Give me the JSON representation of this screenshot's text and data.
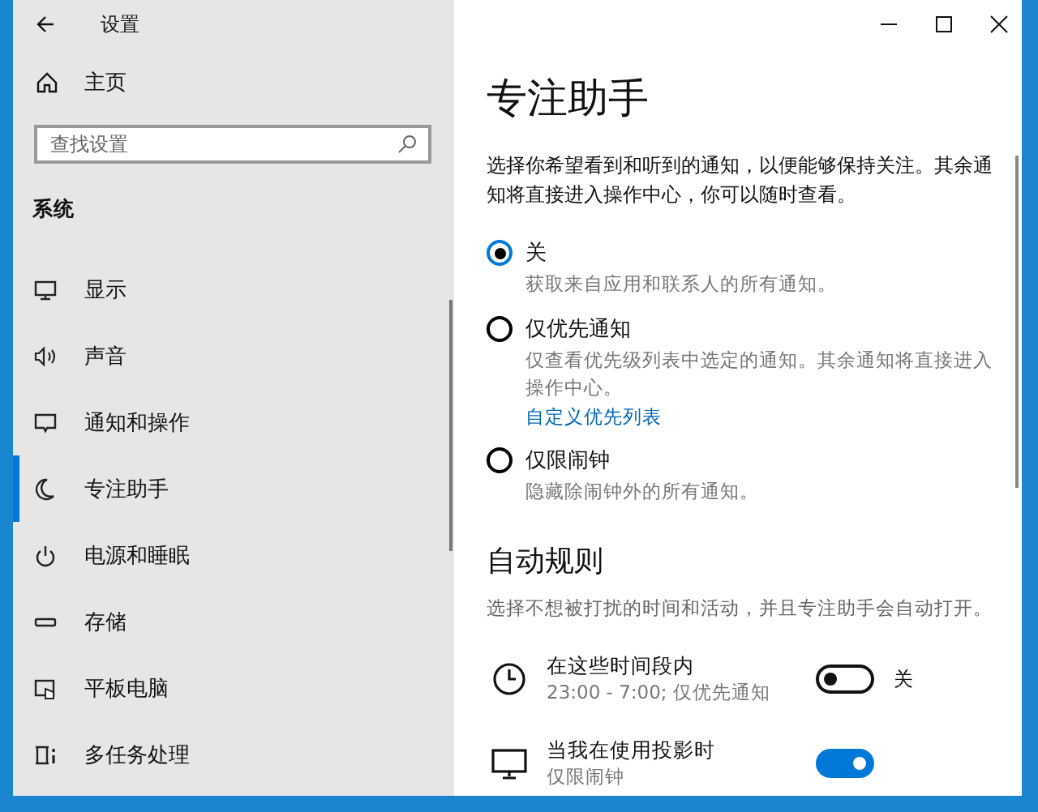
{
  "window": {
    "title": "设置"
  },
  "sidebar": {
    "home": "主页",
    "search": {
      "placeholder": "查找设置"
    },
    "section": "系统",
    "items": [
      {
        "label": "显示",
        "selected": false
      },
      {
        "label": "声音",
        "selected": false
      },
      {
        "label": "通知和操作",
        "selected": false
      },
      {
        "label": "专注助手",
        "selected": true
      },
      {
        "label": "电源和睡眠",
        "selected": false
      },
      {
        "label": "存储",
        "selected": false
      },
      {
        "label": "平板电脑",
        "selected": false
      },
      {
        "label": "多任务处理",
        "selected": false
      }
    ]
  },
  "page": {
    "title": "专注助手",
    "description": "选择你希望看到和听到的通知，以便能够保持关注。其余通知将直接进入操作中心，你可以随时查看。",
    "options": [
      {
        "label": "关",
        "description": "获取来自应用和联系人的所有通知。",
        "selected": true
      },
      {
        "label": "仅优先通知",
        "description": "仅查看优先级列表中选定的通知。其余通知将直接进入操作中心。",
        "link": "自定义优先列表",
        "selected": false
      },
      {
        "label": "仅限闹钟",
        "description": "隐藏除闹钟外的所有通知。",
        "selected": false
      }
    ],
    "rules_title": "自动规则",
    "rules_description": "选择不想被打扰的时间和活动，并且专注助手会自动打开。",
    "rules": [
      {
        "title": "在这些时间段内",
        "detail": "23:00 - 7:00; 仅优先通知",
        "on": false,
        "state_label": "关"
      },
      {
        "title": "当我在使用投影时",
        "detail": "仅限闹钟",
        "on": true
      }
    ]
  }
}
